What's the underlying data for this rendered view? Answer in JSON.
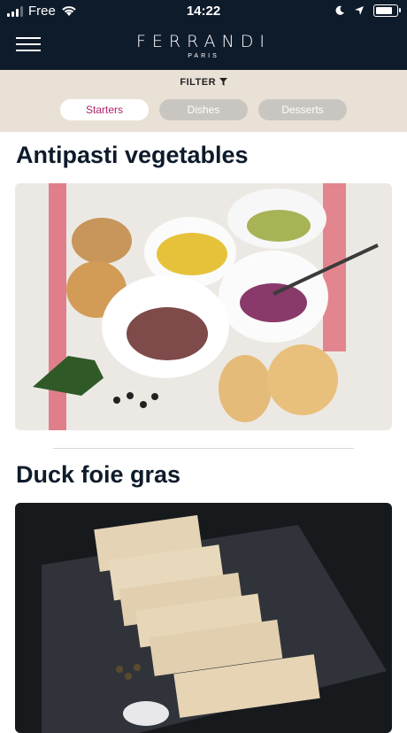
{
  "status": {
    "carrier": "Free",
    "time": "14:22"
  },
  "header": {
    "brand": "FERRANDI",
    "brand_sub": "PARIS"
  },
  "filter": {
    "label": "FILTER"
  },
  "tabs": [
    {
      "label": "Starters",
      "active": true
    },
    {
      "label": "Dishes",
      "active": false
    },
    {
      "label": "Desserts",
      "active": false
    }
  ],
  "recipes": [
    {
      "title": "Antipasti vegetables"
    },
    {
      "title": "Duck foie gras"
    }
  ],
  "colors": {
    "navy": "#0e1b2b",
    "accent": "#b21f6b",
    "filter_bg": "#e9e1d6",
    "tab_inactive": "#c9c6c1"
  }
}
